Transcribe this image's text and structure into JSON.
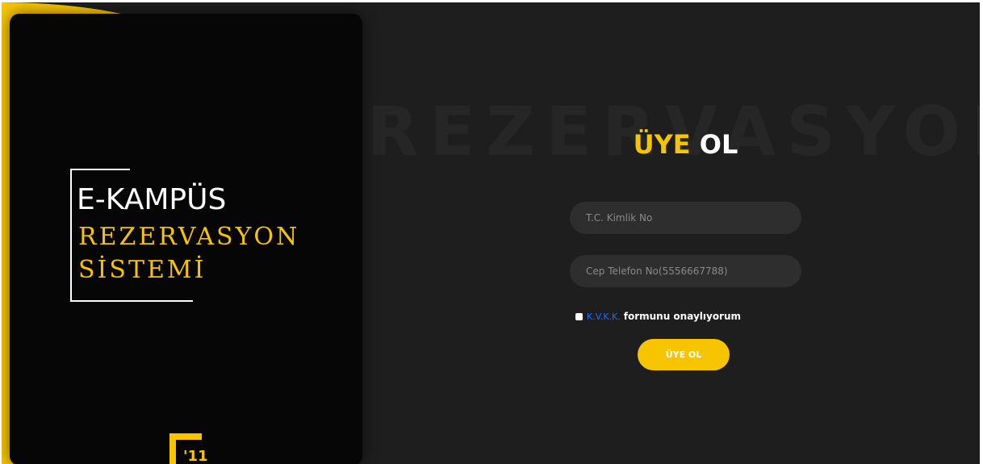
{
  "colors": {
    "accent": "#f7c500",
    "background": "#1e1e1e",
    "panel": "#060606",
    "link": "#1e6cff",
    "input_bg": "#2e2e2e"
  },
  "brand": {
    "line1": "E-KAMPÜS",
    "line2": "REZERVASYON",
    "line3": "SİSTEMİ",
    "logo_icon": "university-logo-icon"
  },
  "watermark": "REZERVASYON",
  "form": {
    "title_accent": "ÜYE",
    "title_main": "OL",
    "tc_placeholder": "T.C. Kimlik No",
    "phone_placeholder": "Cep Telefon No(5556667788)",
    "consent_link": "K.V.K.K.",
    "consent_text": "formunu onaylıyorum",
    "consent_checked": false,
    "submit_label": "ÜYE OL"
  }
}
